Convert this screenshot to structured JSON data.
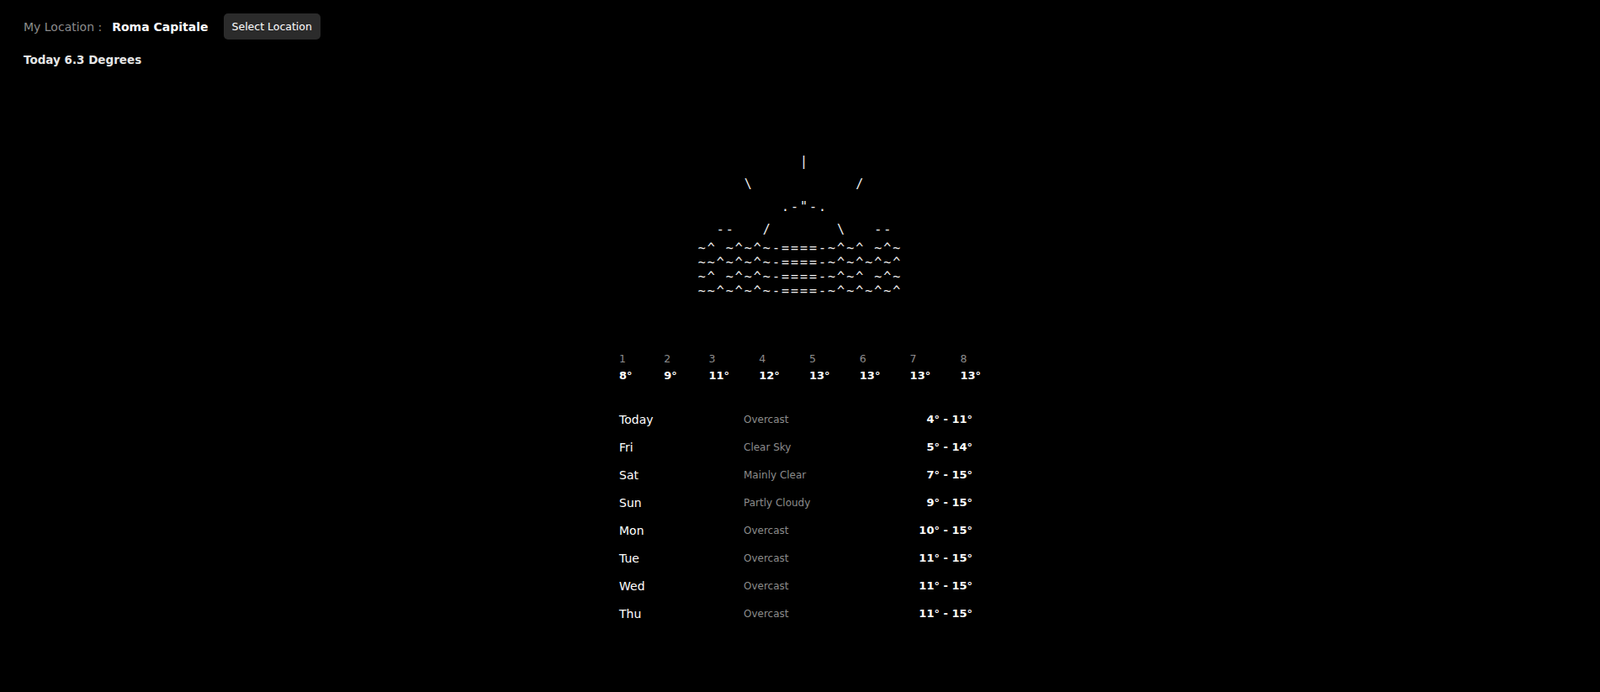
{
  "location": {
    "label": "My Location :",
    "name": "Roma Capitale",
    "button": "Select Location"
  },
  "today": "Today 6.3 Degrees",
  "art": {
    "sky": [
      "           |          ",
      "     \\           /    ",
      "         .-\"-.        ",
      "  --   /       \\   -- "
    ],
    "sea": [
      "~^ ~^~^~-====-~^~^ ~^~",
      "~~^~^~^~-====-~^~^~^~^",
      "~^ ~^~^~-====-~^~^ ~^~",
      "~~^~^~^~-====-~^~^~^~^"
    ]
  },
  "hourly": [
    {
      "hour": "1",
      "temp": "8°"
    },
    {
      "hour": "2",
      "temp": "9°"
    },
    {
      "hour": "3",
      "temp": "11°"
    },
    {
      "hour": "4",
      "temp": "12°"
    },
    {
      "hour": "5",
      "temp": "13°"
    },
    {
      "hour": "6",
      "temp": "13°"
    },
    {
      "hour": "7",
      "temp": "13°"
    },
    {
      "hour": "8",
      "temp": "13°"
    }
  ],
  "daily": [
    {
      "day": "Today",
      "condition": "Overcast",
      "range": "4° - 11°"
    },
    {
      "day": "Fri",
      "condition": "Clear Sky",
      "range": "5° - 14°"
    },
    {
      "day": "Sat",
      "condition": "Mainly Clear",
      "range": "7° - 15°"
    },
    {
      "day": "Sun",
      "condition": "Partly Cloudy",
      "range": "9° - 15°"
    },
    {
      "day": "Mon",
      "condition": "Overcast",
      "range": "10° - 15°"
    },
    {
      "day": "Tue",
      "condition": "Overcast",
      "range": "11° - 15°"
    },
    {
      "day": "Wed",
      "condition": "Overcast",
      "range": "11° - 15°"
    },
    {
      "day": "Thu",
      "condition": "Overcast",
      "range": "11° - 15°"
    }
  ]
}
